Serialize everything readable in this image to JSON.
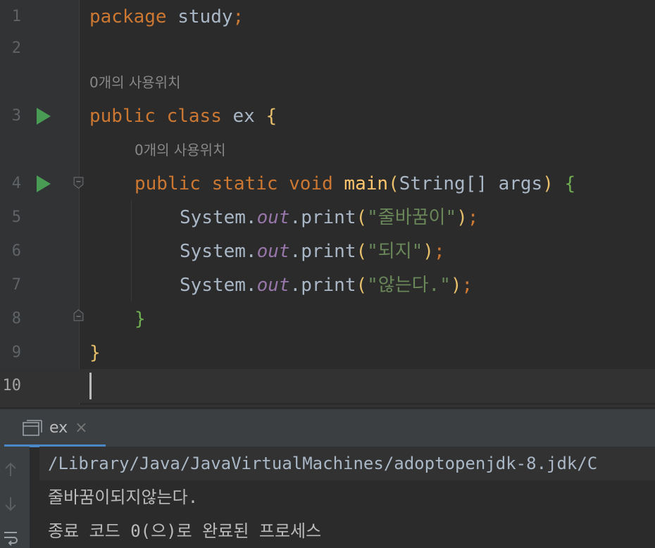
{
  "editor": {
    "lines": [
      {
        "num": "1"
      },
      {
        "num": "2"
      },
      {
        "num": "3"
      },
      {
        "num": "4"
      },
      {
        "num": "5"
      },
      {
        "num": "6"
      },
      {
        "num": "7"
      },
      {
        "num": "8"
      },
      {
        "num": "9"
      },
      {
        "num": "10"
      }
    ],
    "hints": {
      "class_usages": "0개의 사용위치",
      "method_usages": "0개의 사용위치"
    },
    "code": {
      "kw_package": "package",
      "package_name": " study",
      "semicolon": ";",
      "kw_public": "public",
      "kw_class": " class",
      "class_name": " ex ",
      "brace_open": "{",
      "brace_close": "}",
      "kw_static": " static",
      "kw_void": " void",
      "method_name": " main",
      "paren_open": "(",
      "paren_close": ")",
      "params": "String[] args",
      "space": " ",
      "system": "System.",
      "out": "out",
      "print": ".print",
      "str1": "\"줄바꿈이\"",
      "str2": "\"되지\"",
      "str3": "\"않는다.\""
    }
  },
  "icons": {
    "run": "run-triangle-icon",
    "fold": "fold-marker-icon",
    "console": "console-icon",
    "up": "arrow-up-icon",
    "down": "arrow-down-icon",
    "wrap": "soft-wrap-icon"
  },
  "run_panel": {
    "tab_label": "ex",
    "tab_close": "×",
    "console_lines": [
      "/Library/Java/JavaVirtualMachines/adoptopenjdk-8.jdk/C",
      "줄바꿈이되지않는다.",
      "종료 코드 0(으)로 완료된 프로세스"
    ]
  }
}
